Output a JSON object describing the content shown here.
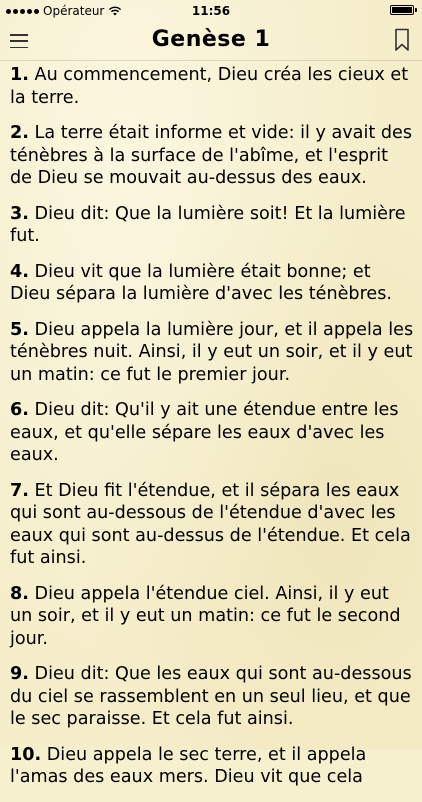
{
  "status_bar": {
    "carrier": "Opérateur",
    "time": "11:56"
  },
  "nav": {
    "title": "Genèse 1"
  },
  "verses": [
    {
      "num": "1.",
      "text": " Au commencement, Dieu créa les cieux et la terre."
    },
    {
      "num": "2.",
      "text": " La terre était informe et vide: il y avait des ténèbres à la surface de l'abîme, et l'esprit de Dieu se mouvait au-dessus des eaux."
    },
    {
      "num": "3.",
      "text": " Dieu dit: Que la lumière soit! Et la lumière fut."
    },
    {
      "num": "4.",
      "text": " Dieu vit que la lumière était bonne; et Dieu sépara la lumière d'avec les ténèbres."
    },
    {
      "num": "5.",
      "text": " Dieu appela la lumière jour, et il appela les ténèbres nuit. Ainsi, il y eut un soir, et il y eut un matin: ce fut le premier jour."
    },
    {
      "num": "6.",
      "text": " Dieu dit: Qu'il y ait une étendue entre les eaux, et qu'elle sépare les eaux d'avec les eaux."
    },
    {
      "num": "7.",
      "text": " Et Dieu fit l'étendue, et il sépara les eaux qui sont au-dessous de l'étendue d'avec les eaux qui sont au-dessus de l'étendue. Et cela fut ainsi."
    },
    {
      "num": "8.",
      "text": " Dieu appela l'étendue ciel. Ainsi, il y eut un soir, et il y eut un matin: ce fut le second jour."
    },
    {
      "num": "9.",
      "text": " Dieu dit: Que les eaux qui sont au-dessous du ciel se rassemblent en un seul lieu, et que le sec paraisse. Et cela fut ainsi."
    },
    {
      "num": "10.",
      "text": " Dieu appela le sec terre, et il appela l'amas des eaux mers. Dieu vit que cela"
    }
  ]
}
